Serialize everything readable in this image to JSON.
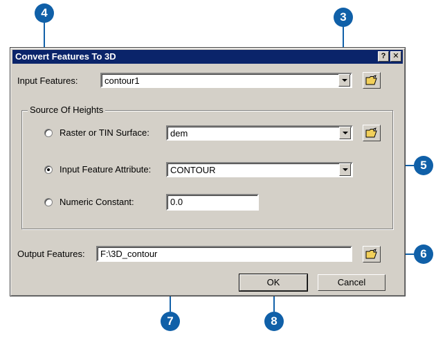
{
  "dialog": {
    "title": "Convert Features To 3D",
    "help_label": "?",
    "close_label": "✕"
  },
  "input_features": {
    "label": "Input Features:",
    "value": "contour1"
  },
  "source_of_heights": {
    "title": "Source Of Heights",
    "options": [
      {
        "label": "Raster or TIN Surface:",
        "value": "dem",
        "selected": false
      },
      {
        "label": "Input Feature Attribute:",
        "value": "CONTOUR",
        "selected": true
      },
      {
        "label": "Numeric Constant:",
        "value": "0.0",
        "selected": false
      }
    ]
  },
  "output_features": {
    "label": "Output Features:",
    "value": "F:\\3D_contour"
  },
  "buttons": {
    "ok_label": "OK",
    "cancel_label": "Cancel"
  },
  "callouts": {
    "c3": "3",
    "c4": "4",
    "c5": "5",
    "c6": "6",
    "c7": "7",
    "c8": "8"
  },
  "colors": {
    "callout": "#1060a8",
    "titlebar": "#0a246a",
    "dialog": "#d4d0c8"
  }
}
